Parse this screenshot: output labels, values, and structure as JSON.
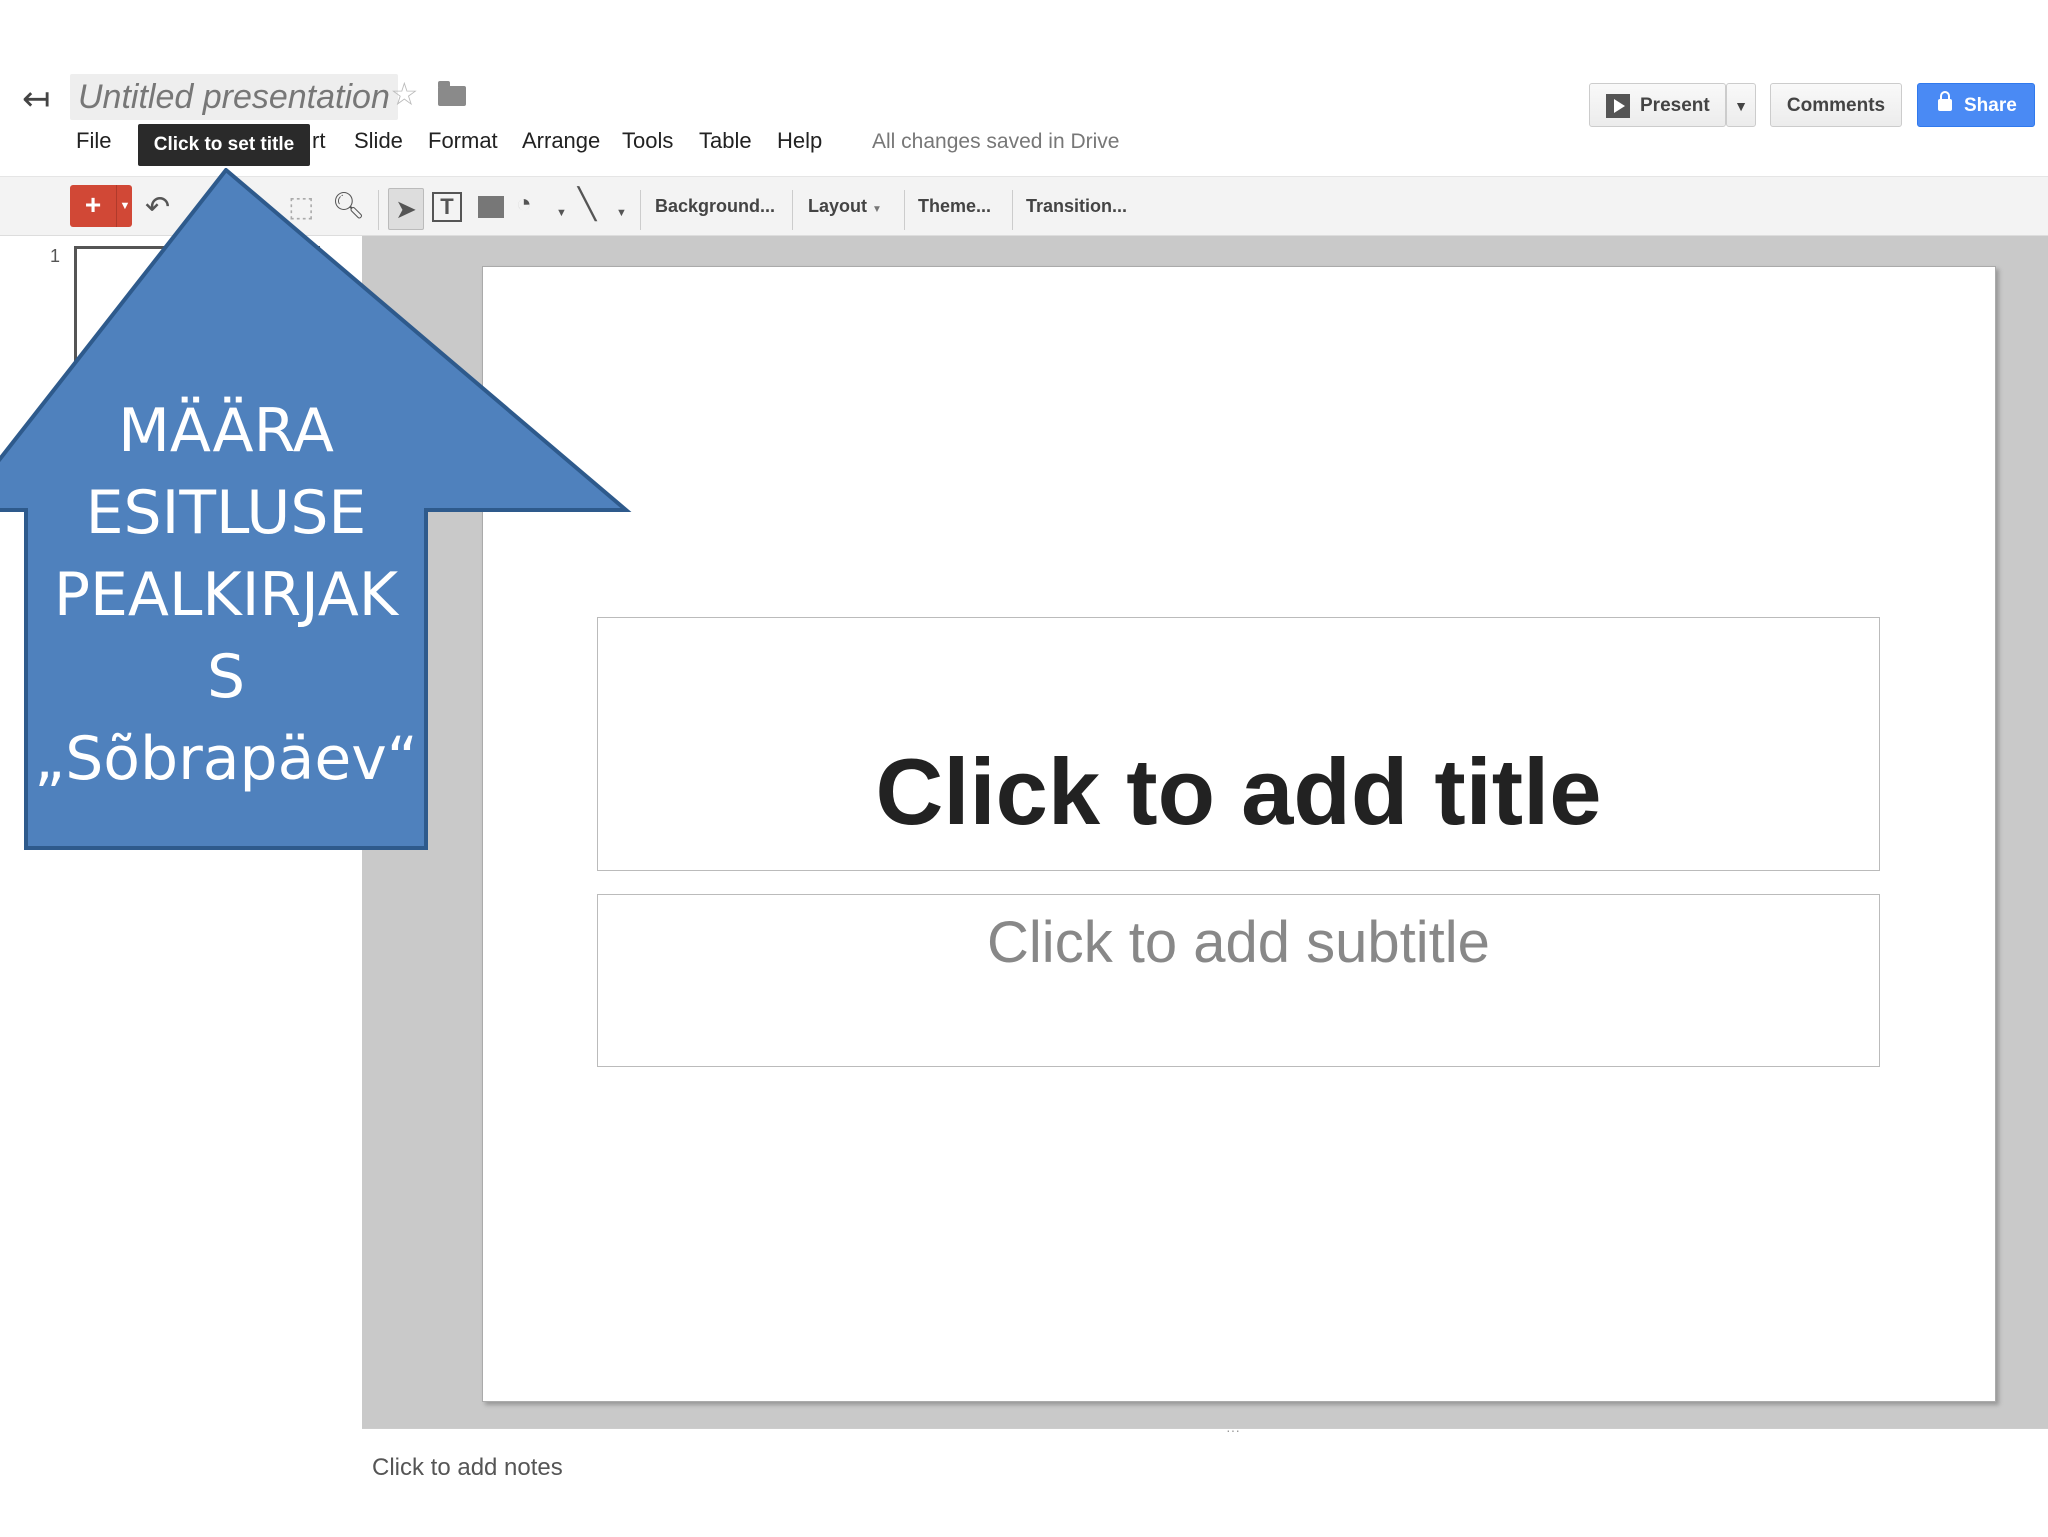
{
  "header": {
    "back_icon": "back-arrow-icon",
    "doc_title": "Untitled presentation",
    "star_icon": "star-icon",
    "folder_icon": "folder-icon",
    "save_status": "All changes saved in Drive",
    "tooltip": "Click to set title"
  },
  "menu": {
    "file": "File",
    "insert_partial": "rt",
    "slide": "Slide",
    "format": "Format",
    "arrange": "Arrange",
    "tools": "Tools",
    "table": "Table",
    "help": "Help"
  },
  "actions": {
    "present": "Present",
    "comments": "Comments",
    "share": "Share"
  },
  "toolbar": {
    "new_slide": "+",
    "background": "Background...",
    "layout": "Layout",
    "theme": "Theme...",
    "transition": "Transition..."
  },
  "filmstrip": {
    "slide_number": "1"
  },
  "slide": {
    "title_placeholder": "Click to add title",
    "subtitle_placeholder": "Click to add subtitle"
  },
  "notes": {
    "placeholder": "Click to add notes",
    "handle": "···"
  },
  "callout": {
    "lines": [
      "MÄÄRA",
      "ESITLUSE",
      "PEALKIRJAK",
      "S",
      "„Sõbrapäev“"
    ]
  },
  "colors": {
    "callout_fill": "#4f81bd",
    "callout_border": "#2e5a8c",
    "share_blue": "#4a8af4",
    "new_slide_red": "#d14836"
  }
}
